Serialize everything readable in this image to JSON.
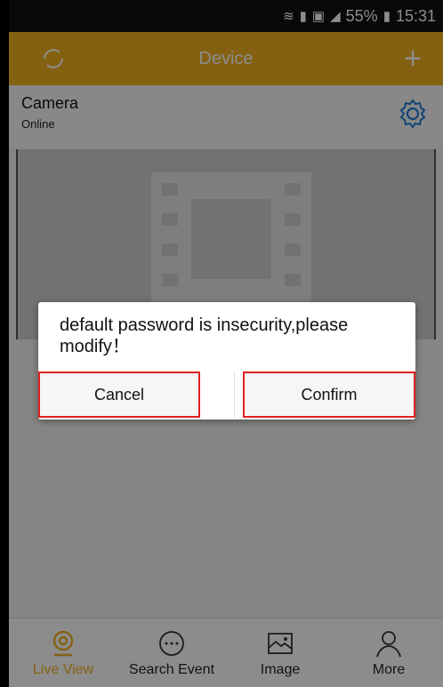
{
  "status_bar": {
    "battery": "55%",
    "time": "15:31",
    "icons": [
      "wifi-icon",
      "sim-icon",
      "image-icon",
      "signal-icon",
      "battery-icon"
    ]
  },
  "title_bar": {
    "title": "Device",
    "left_icon": "refresh-icon",
    "right_label": "+"
  },
  "device": {
    "name": "Camera",
    "status": "Online",
    "settings_icon": "gear-icon"
  },
  "dialog": {
    "message": "default password is insecurity,please modify！",
    "cancel_label": "Cancel",
    "confirm_label": "Confirm"
  },
  "tabs": [
    {
      "label": "Live View",
      "icon": "camera-icon",
      "active": true
    },
    {
      "label": "Search Event",
      "icon": "chat-icon",
      "active": false
    },
    {
      "label": "Image",
      "icon": "image-icon",
      "active": false
    },
    {
      "label": "More",
      "icon": "person-icon",
      "active": false
    }
  ],
  "colors": {
    "accent": "#f0b11e",
    "highlight_border": "#e02020"
  }
}
